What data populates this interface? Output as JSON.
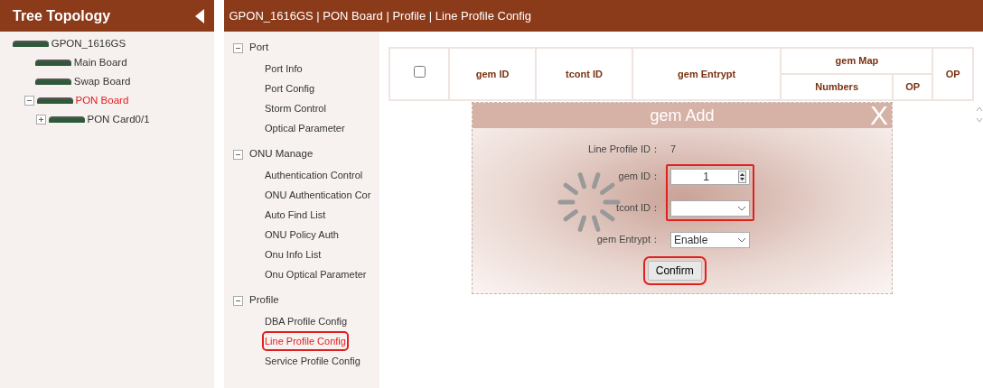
{
  "tree_panel": {
    "title": "Tree Topology",
    "tree": [
      {
        "label": "GPON_1616GS",
        "selected": false,
        "children": [
          {
            "label": "Main Board",
            "selected": false
          },
          {
            "label": "Swap Board",
            "selected": false
          },
          {
            "label": "PON Board",
            "selected": true,
            "expanded": true,
            "children": [
              {
                "label": "PON Card0/1",
                "selected": false,
                "expanded": false
              }
            ]
          }
        ]
      }
    ]
  },
  "breadcrumb": "GPON_1616GS | PON Board | Profile | Line Profile Config",
  "nav": [
    {
      "label": "Port",
      "expanded": true,
      "items": [
        {
          "label": "Port Info",
          "selected": false,
          "highlighted": false
        },
        {
          "label": "Port Config",
          "selected": false,
          "highlighted": false
        },
        {
          "label": "Storm Control",
          "selected": false,
          "highlighted": false
        },
        {
          "label": "Optical Parameter",
          "selected": false,
          "highlighted": false
        }
      ]
    },
    {
      "label": "ONU Manage",
      "expanded": true,
      "items": [
        {
          "label": "Authentication Control",
          "selected": false,
          "highlighted": false
        },
        {
          "label": "ONU Authentication Cor",
          "selected": false,
          "highlighted": false
        },
        {
          "label": "Auto Find List",
          "selected": false,
          "highlighted": false
        },
        {
          "label": "ONU Policy Auth",
          "selected": false,
          "highlighted": false
        },
        {
          "label": "Onu Info List",
          "selected": false,
          "highlighted": false
        },
        {
          "label": "Onu Optical Parameter",
          "selected": false,
          "highlighted": false
        }
      ]
    },
    {
      "label": "Profile",
      "expanded": true,
      "items": [
        {
          "label": "DBA Profile Config",
          "selected": false,
          "highlighted": false
        },
        {
          "label": "Line Profile Config",
          "selected": true,
          "highlighted": true
        },
        {
          "label": "Service Profile Config",
          "selected": false,
          "highlighted": false
        }
      ]
    }
  ],
  "table": {
    "select_all_checked": false,
    "columns": [
      "gem ID",
      "tcont ID",
      "gem Entrypt",
      {
        "label": "gem Map",
        "children": [
          "Numbers",
          "OP"
        ]
      },
      "OP"
    ]
  },
  "dialog": {
    "title": "gem Add",
    "close": "X",
    "loading": true,
    "fields": [
      {
        "kind": "static",
        "label": "Line Profile ID：",
        "value": "7",
        "highlighted": false
      },
      {
        "kind": "spin",
        "label": "gem ID：",
        "value": "1",
        "highlighted": true
      },
      {
        "kind": "select",
        "label": "tcont ID：",
        "highlighted": true
      },
      {
        "kind": "select",
        "label": "gem Entrypt：",
        "value": "Enable",
        "highlighted": false
      }
    ],
    "confirm": {
      "label": "Confirm",
      "highlighted": true
    }
  }
}
